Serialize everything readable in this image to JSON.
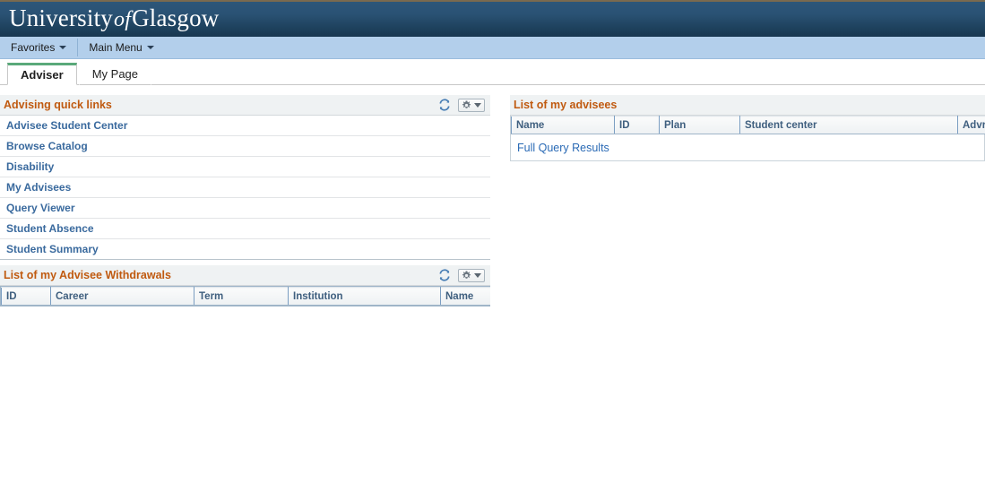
{
  "branding": {
    "logo_part1": "University",
    "logo_of": "of",
    "logo_part2": "Glasgow"
  },
  "menu": {
    "items": [
      {
        "label": "Favorites",
        "icon": "chevron-down-icon"
      },
      {
        "label": "Main Menu",
        "icon": "chevron-down-icon"
      }
    ]
  },
  "tabs": [
    {
      "label": "Adviser",
      "active": true
    },
    {
      "label": "My Page",
      "active": false
    }
  ],
  "pagelets": {
    "quick_links": {
      "title": "Advising quick links",
      "refresh_icon": "refresh-icon",
      "gear_icon": "gear-icon",
      "links": [
        "Advisee Student Center",
        "Browse Catalog",
        "Disability",
        "My Advisees",
        "Query Viewer",
        "Student Absence",
        "Student Summary"
      ]
    },
    "withdrawals": {
      "title": "List of my Advisee Withdrawals",
      "refresh_icon": "refresh-icon",
      "gear_icon": "gear-icon",
      "columns": [
        "ID",
        "Career",
        "Term",
        "Institution",
        "Name"
      ],
      "rows": []
    },
    "advisees": {
      "title": "List of my advisees",
      "columns": [
        "Name",
        "ID",
        "Plan",
        "Student center",
        "Advr. R"
      ],
      "rows": [],
      "footer_link": "Full Query Results"
    }
  },
  "colors": {
    "header_dark": "#1e415d",
    "header_light": "#2d5679",
    "menu_bar": "#b3cfeb",
    "pagelet_title": "#c05a10",
    "link_blue": "#3a6a9e",
    "tab_accent": "#5aa97a",
    "grid_header_text": "#3f5f7f"
  }
}
